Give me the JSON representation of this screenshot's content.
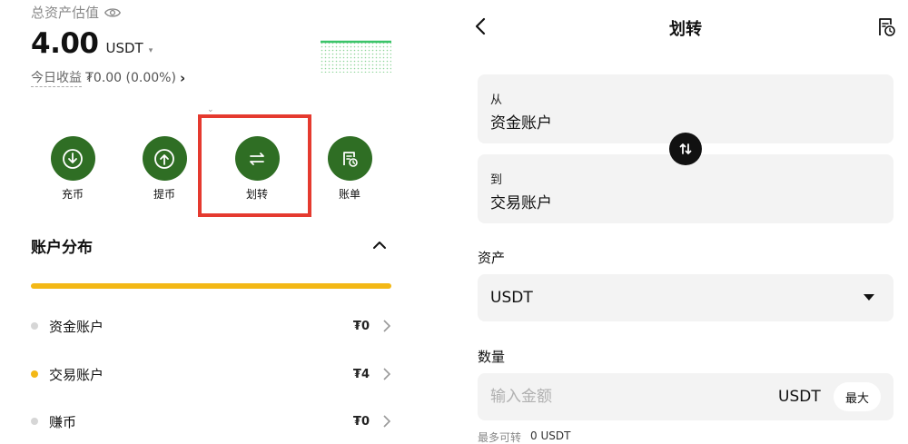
{
  "overview": {
    "total_label": "总资产估值",
    "amount": "4.00",
    "unit": "USDT",
    "caret": "▾",
    "today_label": "今日收益",
    "today_value": "₮0.00 (0.00%)",
    "today_chevron": "›"
  },
  "actions": [
    {
      "label": "充币",
      "icon": "deposit-icon"
    },
    {
      "label": "提币",
      "icon": "withdraw-icon"
    },
    {
      "label": "划转",
      "icon": "transfer-icon"
    },
    {
      "label": "账单",
      "icon": "bill-icon"
    }
  ],
  "distribution": {
    "title": "账户分布",
    "accounts": [
      {
        "name": "资金账户",
        "value": "₮0",
        "dot_color": "#d6d6d6"
      },
      {
        "name": "交易账户",
        "value": "₮4",
        "dot_color": "#f3b816"
      },
      {
        "name": "赚币",
        "value": "₮0",
        "dot_color": "#d6d6d6"
      }
    ],
    "bar_color": "#f3b816"
  },
  "transfer": {
    "title": "划转",
    "from_label": "从",
    "from_value": "资金账户",
    "to_label": "到",
    "to_value": "交易账户",
    "asset_label": "资产",
    "asset_value": "USDT",
    "qty_label": "数量",
    "qty_placeholder": "输入金额",
    "qty_unit": "USDT",
    "max_label": "最大",
    "avail_label": "最多可转",
    "avail_value": "0 USDT"
  },
  "colors": {
    "brand_green": "#2f6e24",
    "highlight_red": "#e53a2f",
    "accent_yellow": "#f3b816"
  }
}
